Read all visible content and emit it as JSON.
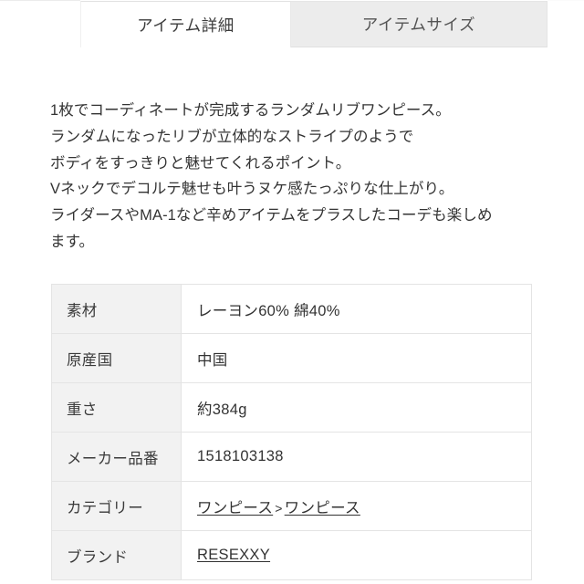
{
  "tabs": [
    {
      "label": "アイテム詳細",
      "state": "active"
    },
    {
      "label": "アイテムサイズ",
      "state": "inactive"
    }
  ],
  "description": {
    "lines": [
      "1枚でコーディネートが完成するランダムリブワンピース。",
      "ランダムになったリブが立体的なストライプのようで",
      "ボディをすっきりと魅せてくれるポイント。",
      "Vネックでデコルテ魅せも叶うヌケ感たっぷりな仕上がり。",
      "ライダースやMA-1など辛めアイテムをプラスしたコーデも楽しめ",
      "ます。"
    ]
  },
  "info_table": {
    "rows": [
      {
        "label": "素材",
        "value": "レーヨン60% 綿40%",
        "type": "text"
      },
      {
        "label": "原産国",
        "value": "中国",
        "type": "text"
      },
      {
        "label": "重さ",
        "value": "約384g",
        "type": "text"
      },
      {
        "label": "メーカー品番",
        "value": "1518103138",
        "type": "text"
      },
      {
        "label": "カテゴリー",
        "type": "links",
        "link1": "ワンピース",
        "separator": ">",
        "link2": "ワンピース"
      },
      {
        "label": "ブランド",
        "value": "RESEXXY",
        "type": "link"
      }
    ]
  },
  "colors": {
    "page_bg": "#ffffff",
    "tab_inactive_bg": "#ececec",
    "table_header_bg": "#f2f2f2",
    "border": "#e4e4e4",
    "text": "#333333"
  }
}
